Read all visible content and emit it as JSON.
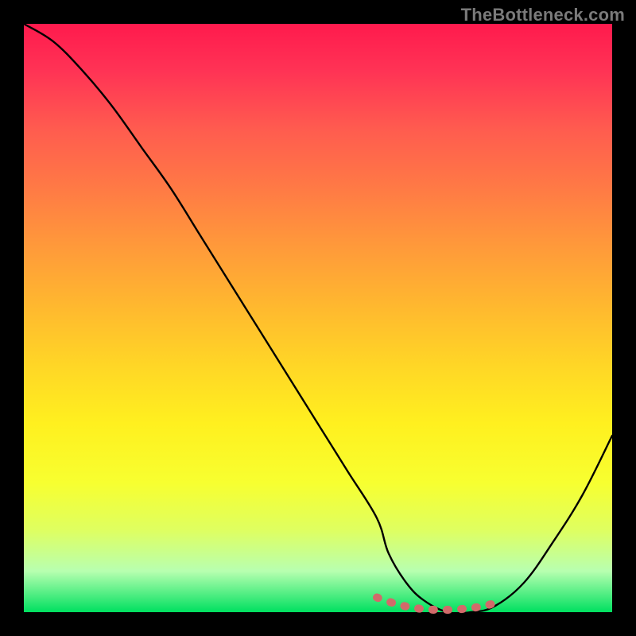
{
  "watermark": "TheBottleneck.com",
  "chart_data": {
    "type": "line",
    "title": "",
    "xlabel": "",
    "ylabel": "",
    "ylim": [
      0,
      100
    ],
    "xlim": [
      0,
      100
    ],
    "series": [
      {
        "name": "bottleneck-curve",
        "x": [
          0,
          5,
          10,
          15,
          20,
          25,
          30,
          35,
          40,
          45,
          50,
          55,
          60,
          62,
          65,
          68,
          72,
          76,
          80,
          85,
          90,
          95,
          100
        ],
        "values": [
          100,
          97,
          92,
          86,
          79,
          72,
          64,
          56,
          48,
          40,
          32,
          24,
          16,
          10,
          5,
          2,
          0,
          0,
          1,
          5,
          12,
          20,
          30
        ]
      },
      {
        "name": "optimal-range-marker",
        "x": [
          60,
          62,
          64,
          66,
          68,
          70,
          72,
          74,
          76,
          78,
          80
        ],
        "values": [
          2.5,
          1.8,
          1.2,
          0.8,
          0.5,
          0.4,
          0.4,
          0.5,
          0.7,
          1.0,
          1.5
        ]
      }
    ],
    "accent_color": "#d26a6a",
    "grid": false,
    "legend": false
  }
}
